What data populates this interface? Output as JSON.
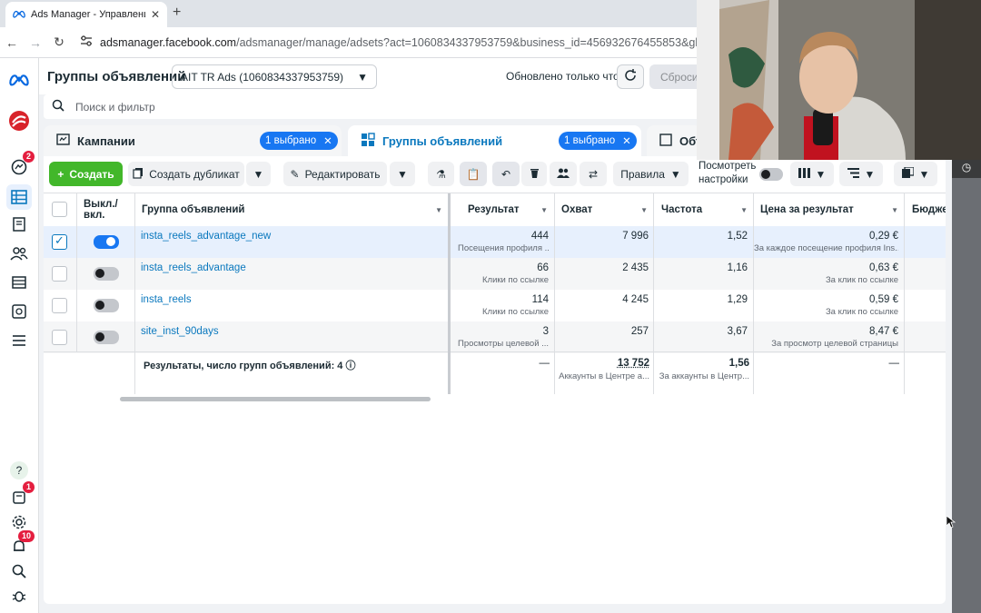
{
  "browser": {
    "tab_title": "Ads Manager - Управление р",
    "url_host": "adsmanager.facebook.com",
    "url_path": "/adsmanager/manage/adsets?act=1060834337953759&business_id=456932676455853&global_scope"
  },
  "leftnav": {
    "badges": {
      "messages": "2",
      "notifications_top": "1",
      "alerts": "10"
    }
  },
  "header": {
    "title": "Группы объявлений",
    "account": "AIT TR Ads (1060834337953759)",
    "updated": "Обновлено только что",
    "reset": "Сбросить"
  },
  "search": {
    "placeholder": "Поиск и фильтр"
  },
  "levels": {
    "campaigns": {
      "label": "Кампании",
      "chip": "1 выбрано"
    },
    "adsets": {
      "label": "Группы объявлений",
      "chip": "1 выбрано"
    },
    "ads": {
      "label": "Объя"
    }
  },
  "toolbar": {
    "create": "Создать",
    "duplicate": "Создать дубликат",
    "edit": "Редактировать",
    "rules": "Правила",
    "preview_settings": "Посмотреть настройки"
  },
  "table": {
    "headers": {
      "toggle": "Выкл./ вкл.",
      "name": "Группа объявлений",
      "result": "Результат",
      "reach": "Охват",
      "frequency": "Частота",
      "cost": "Цена за результат",
      "budget": "Бюджет"
    },
    "rows": [
      {
        "name": "insta_reels_advantage_new",
        "on": true,
        "selected": true,
        "result": "444",
        "result_sub": "Посещения профиля ...",
        "reach": "7 996",
        "freq": "1,52",
        "cost": "0,29 €",
        "cost_sub": "За каждое посещение профиля Ins..."
      },
      {
        "name": "insta_reels_advantage",
        "on": false,
        "selected": false,
        "result": "66",
        "result_sub": "Клики по ссылке",
        "reach": "2 435",
        "freq": "1,16",
        "cost": "0,63 €",
        "cost_sub": "За клик по ссылке"
      },
      {
        "name": "insta_reels",
        "on": false,
        "selected": false,
        "result": "114",
        "result_sub": "Клики по ссылке",
        "reach": "4 245",
        "freq": "1,29",
        "cost": "0,59 €",
        "cost_sub": "За клик по ссылке"
      },
      {
        "name": "site_inst_90days",
        "on": false,
        "selected": false,
        "result": "3",
        "result_sub": "Просмотры целевой ...",
        "reach": "257",
        "freq": "3,67",
        "cost": "8,47 €",
        "cost_sub": "За просмотр целевой страницы"
      }
    ],
    "totals": {
      "label": "Результаты, число групп объявлений: 4",
      "result": "—",
      "reach": "13 752",
      "reach_sub": "Аккаунты в Центре а...",
      "freq": "1,56",
      "freq_sub": "За аккаунты в Центр...",
      "cost": "—"
    }
  },
  "colors": {
    "accent": "#1877f2",
    "create": "#42b72a",
    "link": "#0a78be"
  }
}
